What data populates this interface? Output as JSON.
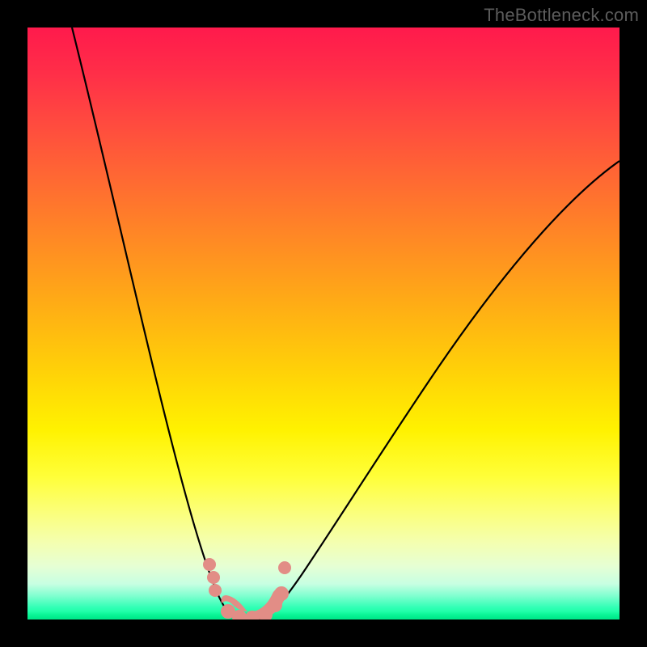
{
  "watermark": "TheBottleneck.com",
  "chart_data": {
    "type": "line",
    "title": "",
    "xlabel": "",
    "ylabel": "",
    "background": {
      "style": "vertical-gradient",
      "meaning": "bottleneck severity — red high, green low/optimal",
      "stops": [
        {
          "pos": 0.0,
          "color": "#ff1a4c"
        },
        {
          "pos": 0.35,
          "color": "#ff8a24"
        },
        {
          "pos": 0.68,
          "color": "#fff200"
        },
        {
          "pos": 1.0,
          "color": "#00ff92"
        }
      ]
    },
    "series": [
      {
        "name": "bottleneck-curve",
        "shape": "V",
        "description": "Single V-shaped curve; minimum near x≈0.37 at y≈0 (optimal). Left branch starts at top-left edge (x≈0.08, y=1.0) and descends steeply. Right branch rises to right edge at roughly (x=1.0, y≈0.77).",
        "x": [
          0.08,
          0.15,
          0.22,
          0.28,
          0.33,
          0.37,
          0.41,
          0.48,
          0.58,
          0.7,
          0.85,
          1.0
        ],
        "y": [
          1.0,
          0.7,
          0.42,
          0.2,
          0.06,
          0.0,
          0.04,
          0.14,
          0.32,
          0.5,
          0.66,
          0.77
        ]
      }
    ],
    "markers": {
      "name": "highlighted-points",
      "color": "#e28d86",
      "points": [
        {
          "x": 0.31,
          "y": 0.09
        },
        {
          "x": 0.315,
          "y": 0.07
        },
        {
          "x": 0.32,
          "y": 0.05
        },
        {
          "x": 0.34,
          "y": 0.015
        },
        {
          "x": 0.36,
          "y": 0.004
        },
        {
          "x": 0.38,
          "y": 0.003
        },
        {
          "x": 0.4,
          "y": 0.008
        },
        {
          "x": 0.42,
          "y": 0.025
        },
        {
          "x": 0.43,
          "y": 0.045
        },
        {
          "x": 0.435,
          "y": 0.085
        }
      ]
    },
    "xlim": [
      0,
      1
    ],
    "ylim": [
      0,
      1
    ],
    "axes_visible": false,
    "legend": false
  }
}
